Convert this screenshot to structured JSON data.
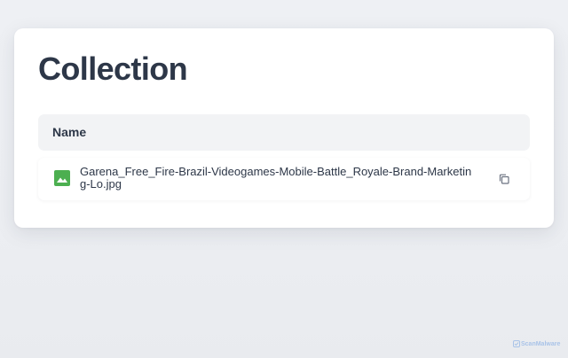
{
  "page": {
    "title": "Collection"
  },
  "table": {
    "header": "Name",
    "rows": [
      {
        "icon": "image-file-icon",
        "name": "Garena_Free_Fire-Brazil-Videogames-Mobile-Battle_Royale-Brand-Marketing-Lo.jpg",
        "action_icon": "copy-icon"
      }
    ]
  },
  "watermark": {
    "text": "ScanMalware",
    "icon": "scanmalware-logo-icon"
  },
  "colors": {
    "title": "#2d3748",
    "header_bg": "#f2f3f5",
    "image_icon": "#4caf50",
    "copy_icon": "#6b7280",
    "watermark": "#a9c3e8"
  }
}
